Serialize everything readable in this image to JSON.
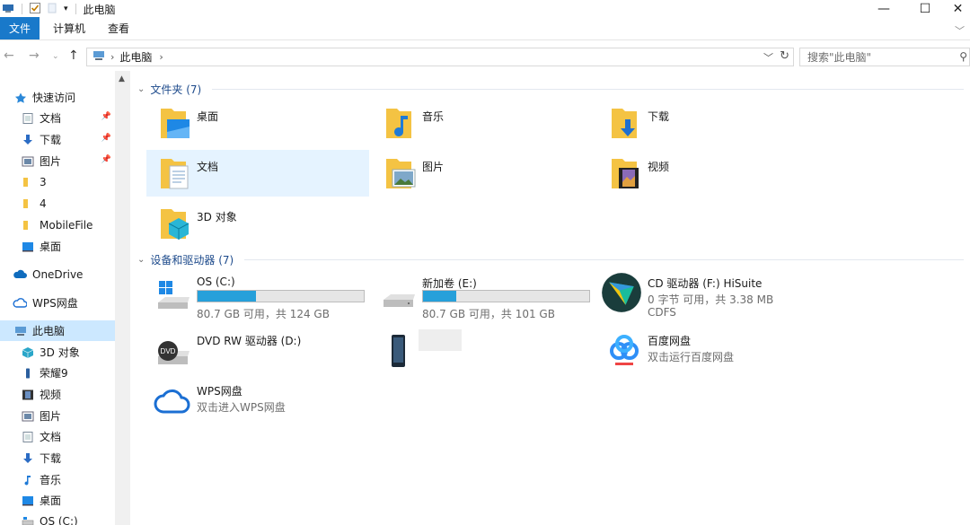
{
  "window": {
    "title": "此电脑"
  },
  "ribbon": {
    "tabs": [
      "文件",
      "计算机",
      "查看"
    ]
  },
  "address": {
    "location": "此电脑",
    "search_placeholder": "搜索\"此电脑\""
  },
  "sidebar": {
    "items": [
      {
        "label": "快速访问",
        "icon": "star-icon"
      },
      {
        "label": "文档",
        "icon": "document-icon"
      },
      {
        "label": "下载",
        "icon": "download-arrow-icon"
      },
      {
        "label": "图片",
        "icon": "picture-icon"
      },
      {
        "label": "3",
        "icon": "folder-icon"
      },
      {
        "label": "4",
        "icon": "folder-icon"
      },
      {
        "label": "MobileFile",
        "icon": "folder-icon"
      },
      {
        "label": "桌面",
        "icon": "desktop-icon"
      },
      {
        "label": "OneDrive",
        "icon": "cloud-icon"
      },
      {
        "label": "WPS网盘",
        "icon": "cloud-outline-icon"
      },
      {
        "label": "此电脑",
        "icon": "computer-icon"
      },
      {
        "label": "3D 对象",
        "icon": "cube-icon"
      },
      {
        "label": "荣耀9",
        "icon": "phone-icon"
      },
      {
        "label": "视频",
        "icon": "film-icon"
      },
      {
        "label": "图片",
        "icon": "picture-icon"
      },
      {
        "label": "文档",
        "icon": "document-icon"
      },
      {
        "label": "下载",
        "icon": "download-arrow-icon"
      },
      {
        "label": "音乐",
        "icon": "music-note-icon"
      },
      {
        "label": "桌面",
        "icon": "desktop-icon"
      },
      {
        "label": "OS (C:)",
        "icon": "drive-icon"
      }
    ]
  },
  "folders": {
    "header": "文件夹 (7)",
    "items": [
      {
        "label": "桌面",
        "icon": "desktop-folder-icon"
      },
      {
        "label": "音乐",
        "icon": "music-folder-icon"
      },
      {
        "label": "下载",
        "icon": "download-folder-icon"
      },
      {
        "label": "文档",
        "icon": "documents-folder-icon"
      },
      {
        "label": "图片",
        "icon": "pictures-folder-icon"
      },
      {
        "label": "视频",
        "icon": "videos-folder-icon"
      },
      {
        "label": "3D 对象",
        "icon": "3d-objects-folder-icon"
      }
    ]
  },
  "devices": {
    "header": "设备和驱动器 (7)",
    "items": [
      {
        "label": "OS (C:)",
        "detail": "80.7 GB 可用，共 124 GB",
        "used_fraction": 0.35
      },
      {
        "label": "新加卷 (E:)",
        "detail": "80.7 GB 可用，共 101 GB",
        "used_fraction": 0.2
      },
      {
        "label": "CD 驱动器 (F:) HiSuite",
        "detail": "0 字节 可用，共 3.38 MB",
        "detail2": "CDFS"
      },
      {
        "label": "DVD RW 驱动器 (D:)"
      },
      {
        "label": ""
      },
      {
        "label": "百度网盘",
        "detail": "双击运行百度网盘"
      },
      {
        "label": "WPS网盘",
        "detail": "双击进入WPS网盘"
      }
    ]
  },
  "colors": {
    "accent": "#1979ca",
    "selection": "#cce8ff",
    "group_header": "#1e4b8c",
    "bar_fill": "#26a0da"
  }
}
